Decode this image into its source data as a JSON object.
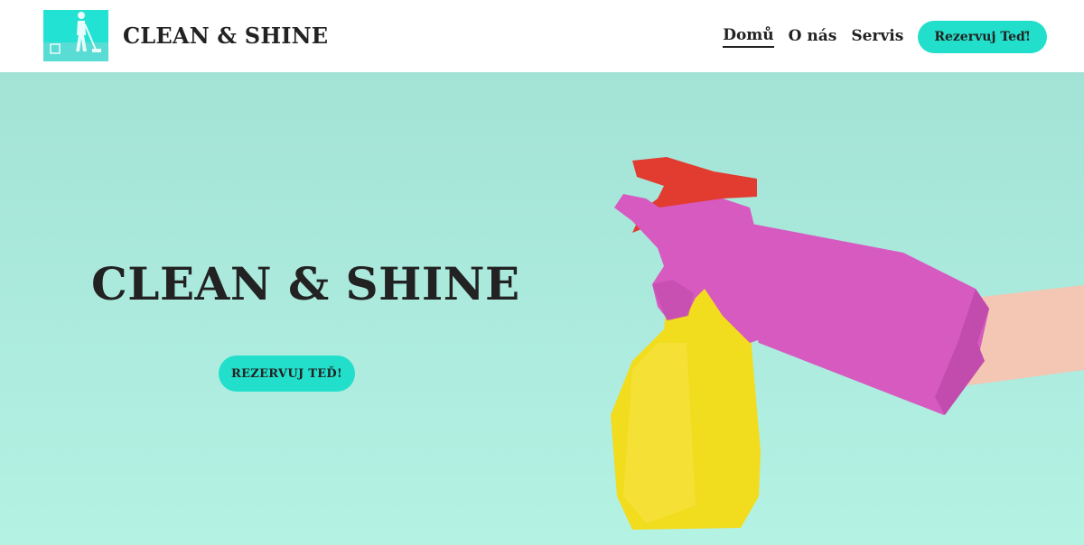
{
  "header": {
    "brand": "CLEAN & SHINE",
    "nav": [
      {
        "label": "Domů",
        "active": true
      },
      {
        "label": "O nás",
        "active": false
      },
      {
        "label": "Servis",
        "active": false
      }
    ],
    "cta_label": "Rezervuj Teď!"
  },
  "hero": {
    "title": "CLEAN & SHINE",
    "cta_label": "REZERVUJ TEĎ!",
    "image": "hand-in-pink-glove-holding-yellow-spray-bottle"
  },
  "colors": {
    "accent": "#22dfcb",
    "hero_bg": "#abeadd",
    "glove": "#d65ac0",
    "bottle": "#f2dc1e",
    "trigger": "#e23b30"
  }
}
